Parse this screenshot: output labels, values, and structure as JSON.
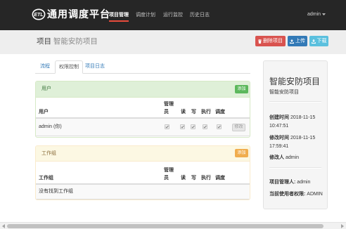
{
  "theme": {
    "navbar_bg": "#262626",
    "active_underline": "#e74c3c",
    "danger": "#d9534f",
    "primary": "#337ab7",
    "info": "#5bc0de",
    "success": "#5cb85c",
    "warning": "#f0ad4e"
  },
  "navbar": {
    "logo_text": "ETL",
    "logo_icon": "etl-logo-icon",
    "brand": "通用调度平台",
    "items": [
      {
        "label": "项目管理",
        "active": true
      },
      {
        "label": "调度计划",
        "active": false
      },
      {
        "label": "运行监控",
        "active": false
      },
      {
        "label": "历史日志",
        "active": false
      }
    ],
    "user": {
      "name": "admin",
      "icon": "caret-down-icon"
    }
  },
  "header": {
    "section": "项目",
    "project_name": "智能安防项目",
    "buttons": {
      "delete": {
        "label": "删除项目",
        "icon": "trash-icon"
      },
      "upload": {
        "label": "上传",
        "icon": "upload-icon"
      },
      "download": {
        "label": "下载",
        "icon": "download-icon"
      }
    }
  },
  "tabs": [
    {
      "label": "流程",
      "active": false
    },
    {
      "label": "权限控制",
      "active": true
    },
    {
      "label": "项目日志",
      "active": false
    }
  ],
  "users_panel": {
    "title": "用户",
    "add_label": "添加",
    "columns": [
      "用户",
      "管理员",
      "读",
      "写",
      "执行",
      "调度"
    ],
    "rows": [
      {
        "name": "admin (你)",
        "permissions": {
          "admin": true,
          "read": true,
          "write": true,
          "execute": true,
          "schedule": true
        },
        "edit_label": "修改",
        "edit_enabled": false
      }
    ]
  },
  "groups_panel": {
    "title": "工作组",
    "add_label": "添加",
    "columns": [
      "工作组",
      "管理员",
      "读",
      "写",
      "执行",
      "调度"
    ],
    "rows": [],
    "empty_text": "没有找到工作组"
  },
  "sidebar": {
    "title": "智能安防项目",
    "subtitle": "智能安防项目",
    "created": {
      "label": "创建时间",
      "value": "2018-11-15 10:47:51"
    },
    "modified": {
      "label": "修改时间",
      "value": "2018-11-15 17:59:41"
    },
    "modified_by": {
      "label": "修改人",
      "value": "admin"
    },
    "manager": {
      "label": "项目管理人:",
      "value": "admin"
    },
    "current_permission": {
      "label": "当前使用者权限:",
      "value": "ADMIN"
    }
  }
}
